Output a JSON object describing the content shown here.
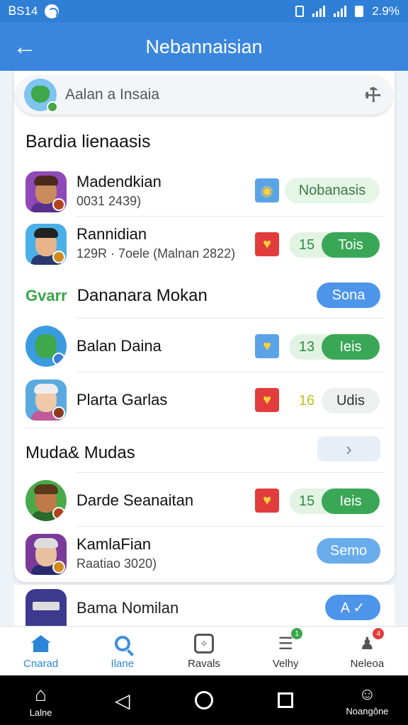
{
  "status_bar": {
    "time": "ᏴS14",
    "battery": "2.9%"
  },
  "app_bar": {
    "title": "Nebannaisian",
    "back_icon": "arrow-left-icon"
  },
  "search": {
    "text": "Aalan a Insaia"
  },
  "sections": {
    "first": "Bardia lienaasis",
    "second": "Dananara Mokan",
    "second_logo": "Gvarr",
    "third": "Muda& Mudas"
  },
  "rows": [
    {
      "name": "Madendkian",
      "sub": "0031 2439)",
      "action": "Nobanasis"
    },
    {
      "name": "Rannidian",
      "sub": "129R · 7oele (Malnan 2822)",
      "count": "15",
      "action": "Tois"
    },
    {
      "action": "Sona"
    },
    {
      "name": "Balan Daina",
      "count": "13",
      "action": "Ieis"
    },
    {
      "name": "Plarta Garlas",
      "count": "16",
      "action": "Udis"
    },
    {
      "action": "›"
    },
    {
      "name": "Darde Seanaitan",
      "count": "15",
      "action": "Ieis"
    },
    {
      "name": "KamlaFian",
      "sub": "Raatiao 3020)",
      "action": "Semo"
    }
  ],
  "peek": {
    "name": "Bama Nomilan",
    "action": "A ✓"
  },
  "bottom_nav": [
    {
      "label": "Cnarad"
    },
    {
      "label": "Ilane"
    },
    {
      "label": "Ravals"
    },
    {
      "label": "Velhy",
      "badge": "1"
    },
    {
      "label": "Neleoa",
      "badge": "4"
    }
  ],
  "system_nav": {
    "home_label": "Lalne",
    "profile_label": "Noangône"
  },
  "colors": {
    "primary": "#3a86de",
    "green": "#3aa756",
    "red": "#e23c3c"
  }
}
